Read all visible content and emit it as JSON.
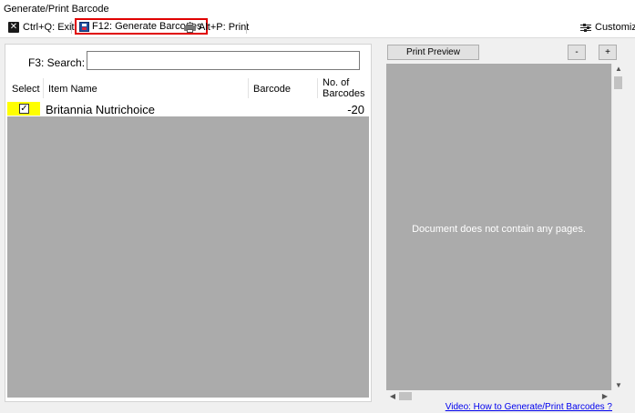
{
  "window": {
    "title": "Generate/Print Barcode"
  },
  "toolbar": {
    "exit_label": "Ctrl+Q: Exit",
    "generate_label": "F12: Generate Barcodes",
    "print_label": "Alt+P: Print",
    "customize_label": "Customize"
  },
  "search": {
    "label": "F3: Search:",
    "value": "",
    "placeholder": ""
  },
  "grid": {
    "columns": [
      "Select",
      "Item Name",
      "Barcode",
      "No. of",
      "Barcodes"
    ],
    "rows": [
      {
        "selected": true,
        "checkmark": "✓",
        "item_name": "Britannia Nutrichoice",
        "barcode": "",
        "count": "-20"
      }
    ]
  },
  "preview": {
    "print_preview_label": "Print Preview",
    "zoom_out_label": "-",
    "zoom_in_label": "+",
    "empty_message": "Document does not contain any pages."
  },
  "footer": {
    "video_link": "Video: How to Generate/Print Barcodes ?"
  },
  "colors": {
    "highlight_box": "#e00000",
    "selected_cell": "#ffff00",
    "empty_area": "#ababab",
    "link": "#0000ee"
  },
  "icons": {
    "exit": "close-icon",
    "generate": "save-icon",
    "print": "printer-icon",
    "customize": "sliders-icon"
  }
}
